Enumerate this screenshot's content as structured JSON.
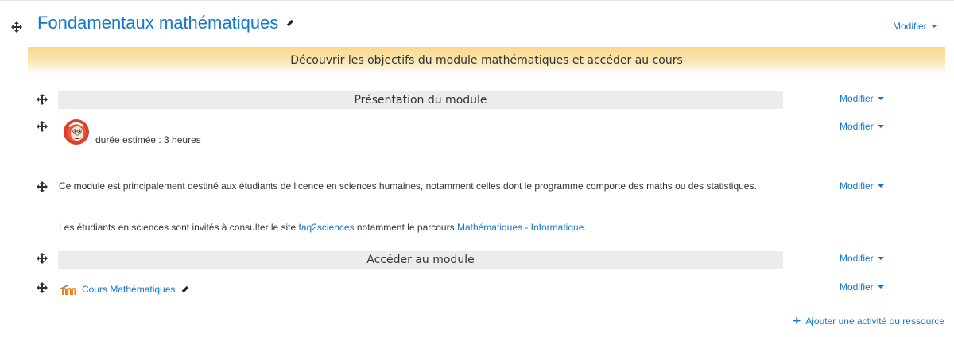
{
  "section": {
    "title": "Fondamentaux mathématiques",
    "edit_menu": "Modifier"
  },
  "banner": {
    "text": "Découvrir les objectifs du module mathématiques et accéder au cours"
  },
  "activities": {
    "presentation": {
      "label": "Présentation du module",
      "edit_menu": "Modifier"
    },
    "duration": {
      "text": "durée estimée : 3 heures",
      "edit_menu": "Modifier"
    },
    "description": {
      "paragraph1": "Ce module est principalement destiné aux étudiants de licence en sciences humaines, notamment celles dont le programme comporte des maths ou des statistiques.",
      "p2_before": "Les étudiants en sciences sont invités à consulter le site ",
      "p2_link1": "faq2sciences",
      "p2_middle": " notamment le parcours ",
      "p2_link2": "Mathématiques - Informatique",
      "p2_after": ".",
      "edit_menu": "Modifier"
    },
    "access": {
      "label": "Accéder au module",
      "edit_menu": "Modifier"
    },
    "course": {
      "name": "Cours Mathématiques",
      "edit_menu": "Modifier"
    }
  },
  "add_activity": {
    "label": "Ajouter une activité ou ressource"
  },
  "icons": {
    "move": "move-icon",
    "edit": "pencil-icon",
    "avatar": "avatar-icon",
    "moodle": "moodle-icon",
    "add": "plus-icon"
  },
  "colors": {
    "link": "#1177d1",
    "banner": "#f9d98a",
    "label_bar": "#ececec"
  }
}
